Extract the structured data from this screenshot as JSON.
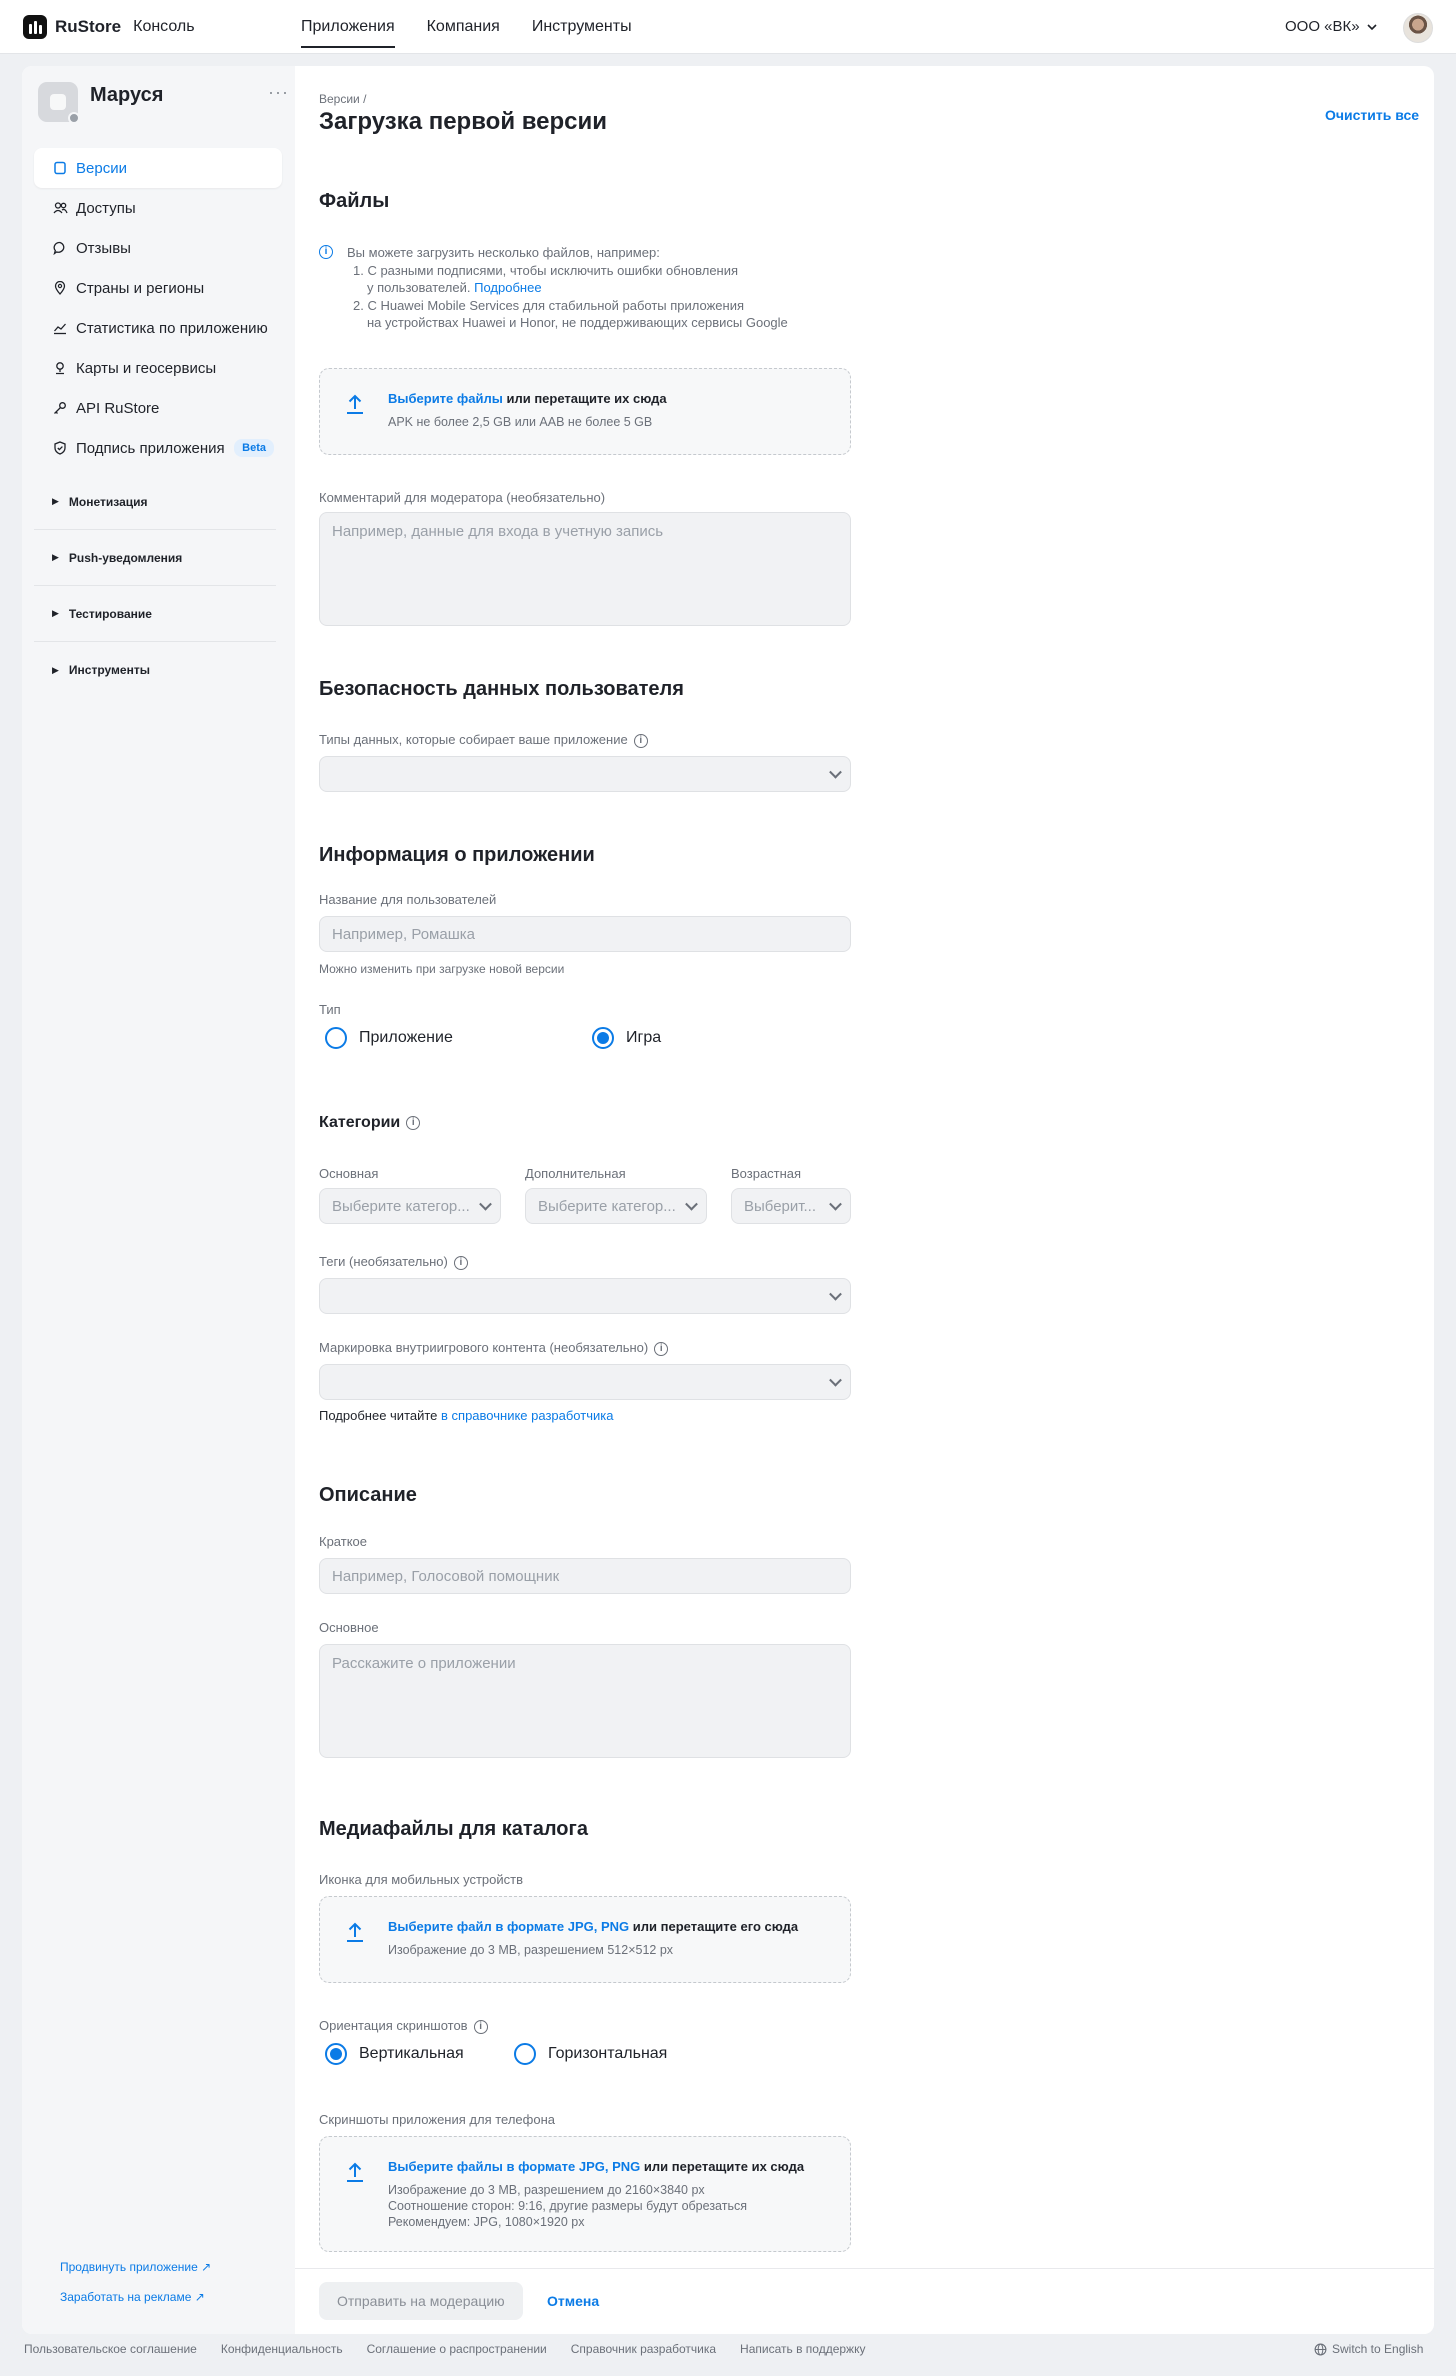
{
  "header": {
    "logo_name": "RuStore",
    "logo_sub": "Консоль",
    "nav": [
      "Приложения",
      "Компания",
      "Инструменты"
    ],
    "company": "ООО «ВК»"
  },
  "sidebar": {
    "app_name": "Маруся",
    "more": "···",
    "items": [
      {
        "label": "Версии",
        "icon": "versions-icon"
      },
      {
        "label": "Доступы",
        "icon": "users-icon"
      },
      {
        "label": "Отзывы",
        "icon": "comment-icon"
      },
      {
        "label": "Страны и регионы",
        "icon": "location-icon"
      },
      {
        "label": "Статистика по приложению",
        "icon": "chart-icon"
      },
      {
        "label": "Карты и геосервисы",
        "icon": "map-pin-icon"
      },
      {
        "label": "API RuStore",
        "icon": "key-icon"
      },
      {
        "label": "Подпись приложения",
        "icon": "shield-icon"
      }
    ],
    "beta": "Beta",
    "groups": [
      "Монетизация",
      "Push-уведомления",
      "Тестирование",
      "Инструменты"
    ],
    "promote": "Продвинуть приложение ↗",
    "earn": "Заработать на рекламе ↗"
  },
  "main": {
    "breadcrumb": "Версии   /",
    "title": "Загрузка первой версии",
    "clear_all": "Очистить все",
    "files": {
      "heading": "Файлы",
      "info_line1": "Вы можете загрузить несколько файлов, например:",
      "info_line2": "1. С разными подписями, чтобы исключить ошибки обновления",
      "info_line3": "у пользователей.",
      "info_more": "Подробнее",
      "info_line4": "2. С Huawei Mobile Services для стабильной работы приложения",
      "info_line5": "на устройствах Huawei и Honor, не поддерживающих сервисы Google",
      "drop_link": "Выберите файлы",
      "drop_rest": " или перетащите их сюда",
      "drop_sub": "APK не более 2,5 GB или AAB не более 5 GB",
      "comment_label": "Комментарий для модератора (необязательно)",
      "comment_placeholder": "Например, данные для входа в учетную запись"
    },
    "security": {
      "heading": "Безопасность данных пользователя",
      "label": "Типы данных, которые собирает ваше приложение"
    },
    "app_info": {
      "heading": "Информация о приложении",
      "name_label": "Название для пользователей",
      "name_placeholder": "Например, Ромашка",
      "name_hint": "Можно изменить при загрузке новой версии",
      "type_label": "Тип",
      "type_app": "Приложение",
      "type_game": "Игра",
      "selected_type": "Игра"
    },
    "categories": {
      "heading": "Категории",
      "main_label": "Основная",
      "main_placeholder": "Выберите категор...",
      "extra_label": "Дополнительная",
      "extra_placeholder": "Выберите категор...",
      "age_label": "Возрастная",
      "age_placeholder": "Выберит...",
      "tags_label": "Теги (необязательно)",
      "marking_label": "Маркировка внутриигрового контента (необязательно)",
      "more_text": "Подробнее читайте ",
      "more_link": "в справочнике разработчика"
    },
    "description": {
      "heading": "Описание",
      "short_label": "Краткое",
      "short_placeholder": "Например, Голосовой помощник",
      "full_label": "Основное",
      "full_placeholder": "Расскажите о приложении"
    },
    "media": {
      "heading": "Медиафайлы для каталога",
      "icon_label": "Иконка для мобильных устройств",
      "icon_link": "Выберите файл в формате JPG, PNG",
      "icon_rest": " или перетащите его сюда",
      "icon_sub": "Изображение до 3 MB, разрешением 512×512 px",
      "orient_label": "Ориентация скриншотов",
      "orient_vertical": "Вертикальная",
      "orient_horizontal": "Горизонтальная",
      "selected_orientation": "Вертикальная",
      "shots_label": "Скриншоты приложения для телефона",
      "shots_link": "Выберите файлы в формате JPG, PNG",
      "shots_rest": " или перетащите их сюда",
      "shots_sub1": "Изображение до 3 MB, разрешением до 2160×3840 px",
      "shots_sub2": "Соотношение сторон: 9:16, другие размеры будут обрезаться",
      "shots_sub3": "Рекомендуем: JPG, 1080×1920 px"
    },
    "actions": {
      "submit": "Отправить на модерацию",
      "cancel": "Отмена"
    }
  },
  "footer": {
    "links": [
      "Пользовательское соглашение",
      "Конфиденциальность",
      "Соглашение о распространении",
      "Справочник разработчика",
      "Написать в поддержку"
    ],
    "lang": "Switch to English"
  },
  "colors": {
    "accent": "#0b7be6",
    "background": "#eef0f3",
    "sidebar": "#f5f6f8"
  }
}
